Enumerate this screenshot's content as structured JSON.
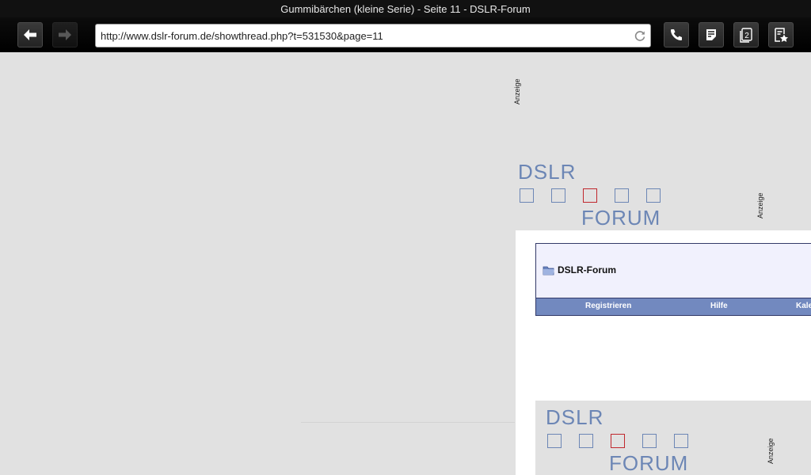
{
  "window": {
    "title": "Gummibärchen (kleine Serie) - Seite 11 - DSLR-Forum"
  },
  "toolbar": {
    "url": "http://www.dslr-forum.de/showthread.php?t=531530&page=11",
    "back_icon": "arrow-left-icon",
    "forward_icon": "arrow-right-icon",
    "reload_icon": "reload-icon",
    "phone_icon": "phone-icon",
    "notes_icon": "notes-icon",
    "tabs_count": "2",
    "bookmark_icon": "bookmark-star-icon"
  },
  "page": {
    "ad_label": "Anzeige",
    "logo": {
      "line1": "DSLR",
      "line2": "FORUM"
    },
    "forum": {
      "title": "DSLR-Forum",
      "nav": [
        "Registrieren",
        "Hilfe",
        "Kale"
      ]
    }
  },
  "colors": {
    "logo_blue": "#6c86b5",
    "logo_red": "#c0272d",
    "nav_blue": "#7289bf"
  }
}
